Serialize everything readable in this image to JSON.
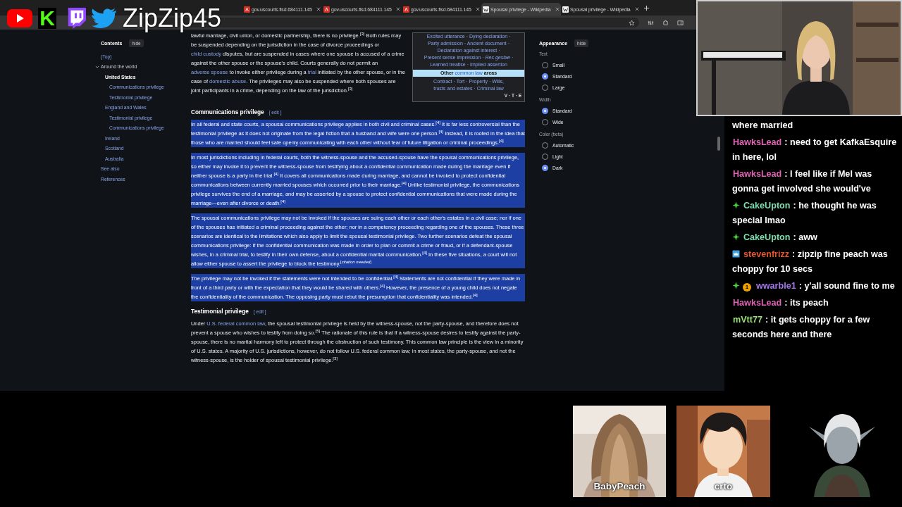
{
  "stream_overlay": {
    "logo_letter": "K",
    "channel": "ZipZip45"
  },
  "browser": {
    "tabs": [
      {
        "kind": "pdf",
        "label": "gov.uscourts.flsd.684111.145",
        "selected": false
      },
      {
        "kind": "pdf",
        "label": "gov.uscourts.flsd.684111.145",
        "selected": false
      },
      {
        "kind": "pdf",
        "label": "gov.uscourts.flsd.684111.145",
        "selected": false
      },
      {
        "kind": "wiki",
        "label": "Spousal privilege - Wikipedia",
        "selected": true
      },
      {
        "kind": "wiki",
        "label": "Spousal privilege - Wikipedia",
        "selected": false
      }
    ]
  },
  "wikipedia": {
    "contents": {
      "title": "Contents",
      "hide": "hide",
      "items": [
        {
          "label": "(Top)",
          "selected": false
        },
        {
          "label": "Around the world",
          "selected": false,
          "expanded": true,
          "children": [
            {
              "label": "United States",
              "selected": true,
              "children": [
                {
                  "label": "Communications privilege",
                  "selected": false
                },
                {
                  "label": "Testimonial privilege",
                  "selected": false
                }
              ]
            },
            {
              "label": "England and Wales",
              "selected": false,
              "children": [
                {
                  "label": "Testimonial privilege",
                  "selected": false
                },
                {
                  "label": "Communications privilege",
                  "selected": false
                }
              ]
            },
            {
              "label": "Ireland",
              "selected": false
            },
            {
              "label": "Scotland",
              "selected": false
            },
            {
              "label": "Australia",
              "selected": false
            }
          ]
        },
        {
          "label": "See also",
          "selected": false
        },
        {
          "label": "References",
          "selected": false
        }
      ]
    },
    "intro": {
      "runs": [
        {
          "kind": "text",
          "text": "lawful marriage, civil union, or domestic partnership, there is no privilege.$^{[3]}$ Both rules may be suspended depending on the jurisdiction in the case of divorce proceedings or "
        },
        {
          "kind": "link",
          "text": "child custody"
        },
        {
          "kind": "text",
          "text": " disputes, but are suspended in cases where one spouse is accused of a crime against the other spouse or the spouse's child. Courts generally do not permit an "
        },
        {
          "kind": "link",
          "text": "adverse spouse"
        },
        {
          "kind": "text",
          "text": " to invoke either privilege during a "
        },
        {
          "kind": "link",
          "text": "trial"
        },
        {
          "kind": "text",
          "text": " initiated by the other spouse, or in the case of "
        },
        {
          "kind": "link",
          "text": "domestic abuse"
        },
        {
          "kind": "text",
          "text": ". The privileges may also be suspended where both spouses are joint participants in a crime, depending on the law of the jurisdiction.$^{[3]}$"
        }
      ]
    },
    "navbox": {
      "lines": [
        "Excited utterance · Dying declaration ·",
        "Party admission · Ancient document ·",
        "Declaration against interest ·",
        "Present sense impression · *Res gestae* ·",
        "Learned treatise · Implied assertion"
      ],
      "header": [
        {
          "kind": "text",
          "text": "Other "
        },
        {
          "kind": "link",
          "text": "common law"
        },
        {
          "kind": "text",
          "text": " areas"
        }
      ],
      "footer_lines": [
        "Contract · Tort · Property · Wills,",
        "trusts and estates · Criminal law"
      ],
      "vte": "V · T · E"
    },
    "sections": [
      {
        "heading": "Communications privilege",
        "edit": "[ edit ]",
        "paragraphs": [
          {
            "selected": true,
            "runs": [
              {
                "kind": "text",
                "text": "In all federal and state courts, a spousal communications privilege applies in both civil and criminal cases.$^{[4]}$ It is far less controversial than the testimonial privilege as it does not originate from the legal fiction that a husband and wife were one person.$^{[4]}$ Instead, it is rooted in the idea that those who are married should feel safe openly communicating with each other without fear of future litigation or criminal proceedings.$^{[4]}$"
              }
            ]
          },
          {
            "selected": true,
            "runs": [
              {
                "kind": "text",
                "text": "In most jurisdictions including in federal courts, both the witness-spouse and the accused-spouse have the spousal communications privilege, so either may invoke it to prevent the witness-spouse from testifying about a confidential communication made during the marriage even if neither spouse is a party in the trial.$^{[4]}$ It covers all communications made during marriage, and cannot be invoked to protect confidential communications between currently married spouses which occurred prior to their marriage.$^{[4]}$ Unlike testimonial privilege, the communications privilege survives the end of a marriage, and may be asserted by a spouse to protect confidential communications that were made during the marriage—even after divorce or death.$^{[4]}$"
              }
            ]
          },
          {
            "selected": true,
            "runs": [
              {
                "kind": "text",
                "text": "The spousal communications privilege may not be invoked if the spouses are suing each other or each other's estates in a civil case; nor if one of the spouses has initiated a criminal proceeding against the other; nor in a competency proceeding regarding one of the spouses. These three scenarios are identical to the limitations which also apply to limit the spousal testimonial privilege. Two further scenarios defeat the spousal communications privilege: if the confidential communication was made in order to plan or commit a crime or fraud, or if a defendant-spouse wishes, in a criminal trial, to testify in their own defense, about a confidential marital communication.$^{[4]}$ In these five situations, a court will not allow either spouse to assert the privilege to block the testimony."
              },
              {
                "kind": "note",
                "text": "[*citation needed*]"
              }
            ]
          },
          {
            "selected": true,
            "runs": [
              {
                "kind": "text",
                "text": "The privilege may not be invoked if the statements were not intended to be confidential.$^{[4]}$ Statements are not confidential if they were made in front of a third party or with the expectation that they would be shared with others.$^{[4]}$ However, the presence of a young child does not negate the confidentiality of the communication. The opposing party must rebut the presumption that confidentiality was intended.$^{[4]}$"
              }
            ]
          }
        ]
      },
      {
        "heading": "Testimonial privilege",
        "edit": "[ edit ]",
        "paragraphs": [
          {
            "selected": false,
            "runs": [
              {
                "kind": "text",
                "text": "Under "
              },
              {
                "kind": "link",
                "text": "U.S. federal common law"
              },
              {
                "kind": "text",
                "text": ", the spousal testimonial privilege is held by the witness-spouse, not the party-spouse, and therefore does not prevent a spouse who wishes to testify from doing so.$^{[5]}$ The rationale of this rule is that if a witness-spouse desires to testify against the party-spouse, there is no marital harmony left to protect through the obstruction of such testimony. This common law principle is the view in a minority of U.S. states. A majority of U.S. jurisdictions, however, do not follow U.S. federal common law; in most states, the party-spouse, and not the witness-spouse, is the holder of spousal testimonial privilege.$^{[3]}$"
              }
            ]
          }
        ]
      }
    ],
    "appearance": {
      "title": "Appearance",
      "hide": "hide",
      "groups": [
        {
          "label": "Text",
          "options": [
            {
              "label": "Small",
              "selected": false
            },
            {
              "label": "Standard",
              "selected": true
            },
            {
              "label": "Large",
              "selected": false
            }
          ]
        },
        {
          "label": "Width",
          "options": [
            {
              "label": "Standard",
              "selected": true
            },
            {
              "label": "Wide",
              "selected": false
            }
          ]
        },
        {
          "label": "Color (beta)",
          "options": [
            {
              "label": "Automatic",
              "selected": false
            },
            {
              "label": "Light",
              "selected": false
            },
            {
              "label": "Dark",
              "selected": true
            }
          ]
        }
      ]
    }
  },
  "chat": {
    "messages": [
      {
        "text": "where married"
      },
      {
        "user": "HawksLead",
        "color": "#e064b4",
        "text": ": need to get KafkaEsquire in here, lol"
      },
      {
        "user": "HawksLead",
        "color": "#e064b4",
        "text": ": I feel like if Mel was gonna get involved she would've"
      },
      {
        "user": "CakeUpton",
        "color": "#7ee0b0",
        "badges": [
          {
            "kind": "gem"
          }
        ],
        "text": ": he thought he was special lmao"
      },
      {
        "user": "CakeUpton",
        "color": "#7ee0b0",
        "badges": [
          {
            "kind": "gem"
          }
        ],
        "text": ": aww"
      },
      {
        "user": "stevenfrizz",
        "color": "#e8552c",
        "badges": [
          {
            "kind": "crown"
          }
        ],
        "text": ": zipzip fine peach was choppy for 10 secs"
      },
      {
        "user": "wwarble1",
        "color": "#a478e8",
        "badges": [
          {
            "kind": "gem"
          },
          {
            "kind": "count",
            "label": "1"
          }
        ],
        "text": ": y'all sound fine to me"
      },
      {
        "user": "HawksLead",
        "color": "#e064b4",
        "text": ": its peach"
      },
      {
        "user": "mVtt77",
        "color": "#9ae07a",
        "text": ": it gets choppy for a few seconds here and there"
      }
    ]
  },
  "avatars": [
    {
      "label": "BabyPeach"
    },
    {
      "kind": "cartoon",
      "label": "crto"
    },
    {
      "kind": "elf"
    }
  ]
}
